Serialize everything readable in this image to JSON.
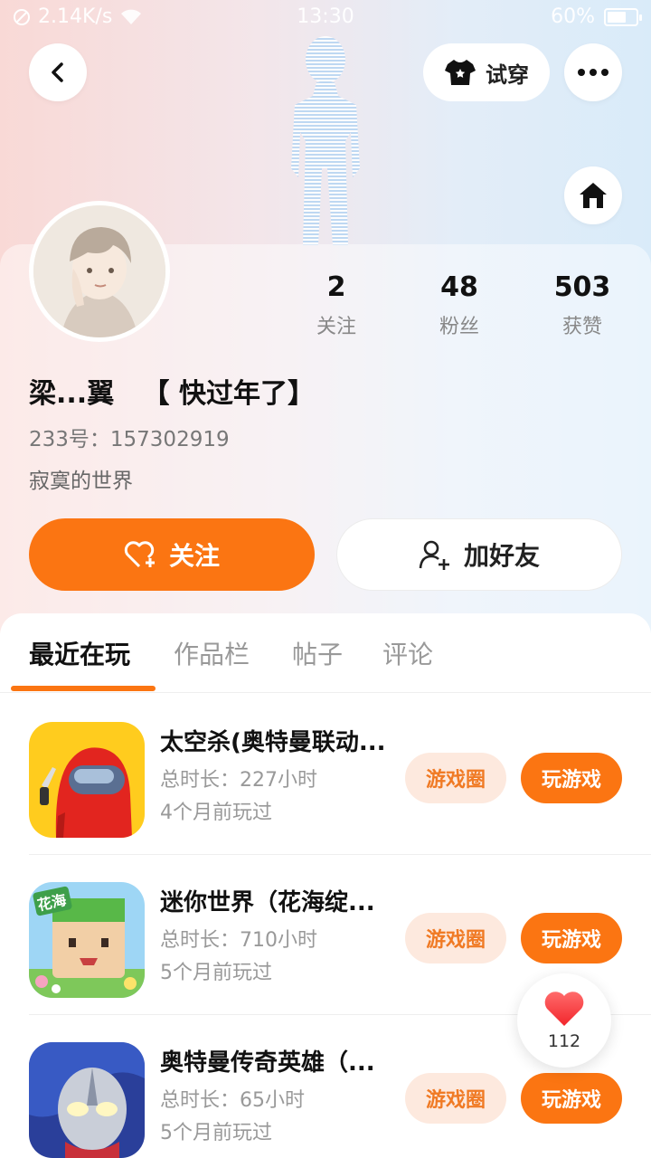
{
  "status_bar": {
    "network_speed": "2.14K/s",
    "time": "13:30",
    "battery": "60%"
  },
  "header": {
    "try_on_label": "试穿"
  },
  "stats": [
    {
      "value": "2",
      "label": "关注"
    },
    {
      "value": "48",
      "label": "粉丝"
    },
    {
      "value": "503",
      "label": "获赞"
    }
  ],
  "profile": {
    "nickname": "梁...翼   【 快过年了】",
    "uid": "233号：157302919",
    "bio": "寂寞的世界"
  },
  "actions": {
    "follow_label": "关注",
    "add_friend_label": "加好友"
  },
  "tabs": [
    {
      "label": "最近在玩",
      "active": true
    },
    {
      "label": "作品栏",
      "active": false
    },
    {
      "label": "帖子",
      "active": false
    },
    {
      "label": "评论",
      "active": false
    }
  ],
  "games": [
    {
      "name": "太空杀(奥特曼联动...",
      "duration": "总时长：227小时",
      "last_played": "4个月前玩过",
      "circle_label": "游戏圈",
      "play_label": "玩游戏",
      "icon": "among-us-style-icon"
    },
    {
      "name": "迷你世界（花海绽...",
      "duration": "总时长：710小时",
      "last_played": "5个月前玩过",
      "circle_label": "游戏圈",
      "play_label": "玩游戏",
      "icon": "mini-world-icon",
      "icon_text": "花海"
    },
    {
      "name": "奥特曼传奇英雄（...",
      "duration": "总时长：65小时",
      "last_played": "5个月前玩过",
      "circle_label": "游戏圈",
      "play_label": "玩游戏",
      "icon": "ultraman-icon"
    }
  ],
  "like_fab": {
    "count": "112"
  },
  "colors": {
    "accent": "#fb7512",
    "circle_bg": "#fde9de",
    "circle_text": "#f07a24"
  }
}
